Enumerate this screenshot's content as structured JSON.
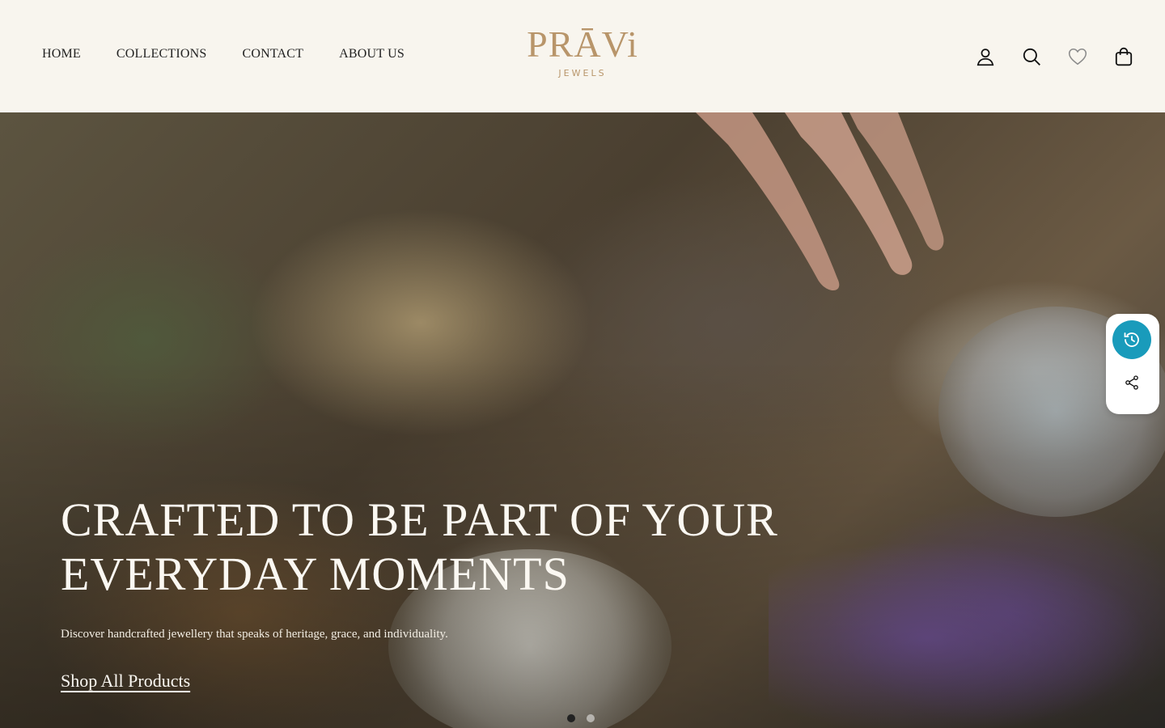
{
  "nav": {
    "items": [
      {
        "label": "HOME"
      },
      {
        "label": "COLLECTIONS"
      },
      {
        "label": "CONTACT"
      },
      {
        "label": "ABOUT US"
      }
    ]
  },
  "logo": {
    "main": "PRĀVi",
    "sub": "JEWELS",
    "color": "#b8956a"
  },
  "header_icons": [
    "user-icon",
    "search-icon",
    "heart-icon",
    "bag-icon"
  ],
  "hero": {
    "title": "CRAFTED TO BE PART OF YOUR EVERYDAY MOMENTS",
    "subtitle": "Discover handcrafted jewellery that speaks of heritage, grace, and individuality.",
    "cta": "Shop All Products"
  },
  "slider": {
    "total": 2,
    "active": 1
  },
  "side_widget": {
    "icons": [
      "history-icon",
      "share-icon"
    ],
    "accent": "#199bbb"
  }
}
